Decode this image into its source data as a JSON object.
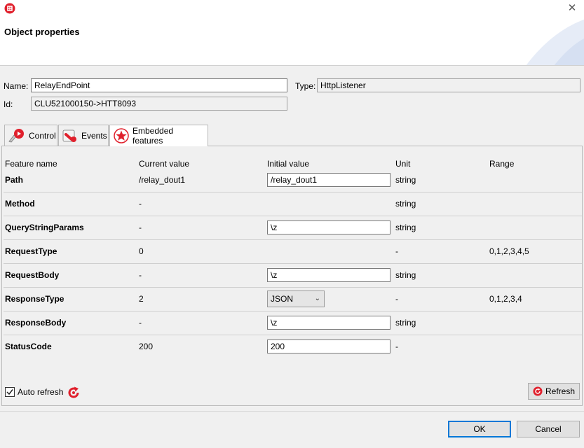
{
  "window": {
    "title": "Object properties"
  },
  "fields": {
    "name_label": "Name:",
    "name_value": "RelayEndPoint",
    "type_label": "Type:",
    "type_value": "HttpListener",
    "id_label": "Id:",
    "id_value": "CLU521000150->HTT8093"
  },
  "tabs": [
    {
      "label": "Control",
      "icon": "control-icon",
      "active": false
    },
    {
      "label": "Events",
      "icon": "events-icon",
      "active": false
    },
    {
      "label": "Embedded features",
      "icon": "star-icon",
      "active": true
    }
  ],
  "table": {
    "headers": [
      "Feature name",
      "Current value",
      "Initial value",
      "Unit",
      "Range"
    ],
    "rows": [
      {
        "name": "Path",
        "current": "/relay_dout1",
        "initial": "/relay_dout1",
        "initial_kind": "input",
        "unit": "string",
        "range": ""
      },
      {
        "name": "Method",
        "current": "-",
        "initial": "",
        "initial_kind": "none",
        "unit": "string",
        "range": ""
      },
      {
        "name": "QueryStringParams",
        "current": "-",
        "initial": "\\z",
        "initial_kind": "input",
        "unit": "string",
        "range": ""
      },
      {
        "name": "RequestType",
        "current": "0",
        "initial": "",
        "initial_kind": "none",
        "unit": "-",
        "range": "0,1,2,3,4,5"
      },
      {
        "name": "RequestBody",
        "current": "-",
        "initial": "\\z",
        "initial_kind": "input",
        "unit": "string",
        "range": ""
      },
      {
        "name": "ResponseType",
        "current": "2",
        "initial": "JSON",
        "initial_kind": "select",
        "unit": "-",
        "range": "0,1,2,3,4"
      },
      {
        "name": "ResponseBody",
        "current": "-",
        "initial": "\\z",
        "initial_kind": "input",
        "unit": "string",
        "range": ""
      },
      {
        "name": "StatusCode",
        "current": "200",
        "initial": "200",
        "initial_kind": "input",
        "unit": "-",
        "range": ""
      }
    ]
  },
  "auto_refresh": {
    "label": "Auto refresh",
    "checked": true
  },
  "buttons": {
    "refresh": "Refresh",
    "ok": "OK",
    "cancel": "Cancel"
  },
  "colors": {
    "accent": "#0078d7",
    "brand_red": "#e0202c"
  }
}
